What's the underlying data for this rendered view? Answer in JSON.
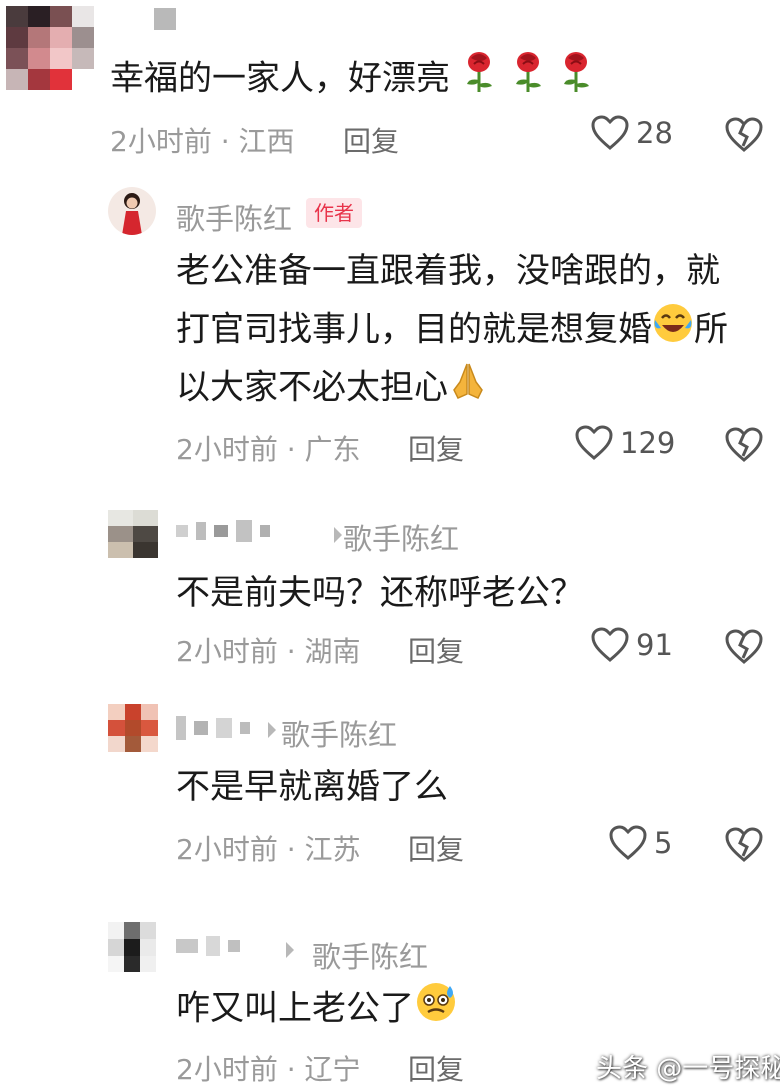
{
  "comments": [
    {
      "text": "幸福的一家人，好漂亮",
      "emojis": [
        "rose-icon",
        "rose-icon",
        "rose-icon"
      ],
      "meta": "2小时前 · 江西",
      "reply_label": "回复",
      "likes": "28"
    },
    {
      "username": "歌手陈红",
      "badge": "作者",
      "text_line1": "老公准备一直跟着我，没啥跟的，就",
      "text_line2": "打官司找事儿，目的就是想复婚",
      "text_line2_tail": "所",
      "text_line3": "以大家不必太担心",
      "meta": "2小时前 · 广东",
      "reply_label": "回复",
      "likes": "129"
    },
    {
      "reply_to": "歌手陈红",
      "text": "不是前夫吗？还称呼老公？",
      "meta": "2小时前 · 湖南",
      "reply_label": "回复",
      "likes": "91"
    },
    {
      "reply_to": "歌手陈红",
      "text": "不是早就离婚了么",
      "meta": "2小时前 · 江苏",
      "reply_label": "回复",
      "likes": "5"
    },
    {
      "reply_to": "歌手陈红",
      "text": "咋又叫上老公了",
      "meta": "2小时前 · 辽宁",
      "reply_label": "回复"
    }
  ],
  "watermark": "头条 @一号探秘人",
  "colors": {
    "author_badge_bg": "#fde5e8",
    "author_badge_text": "#e8334a",
    "meta_text": "#9a9a9a"
  }
}
